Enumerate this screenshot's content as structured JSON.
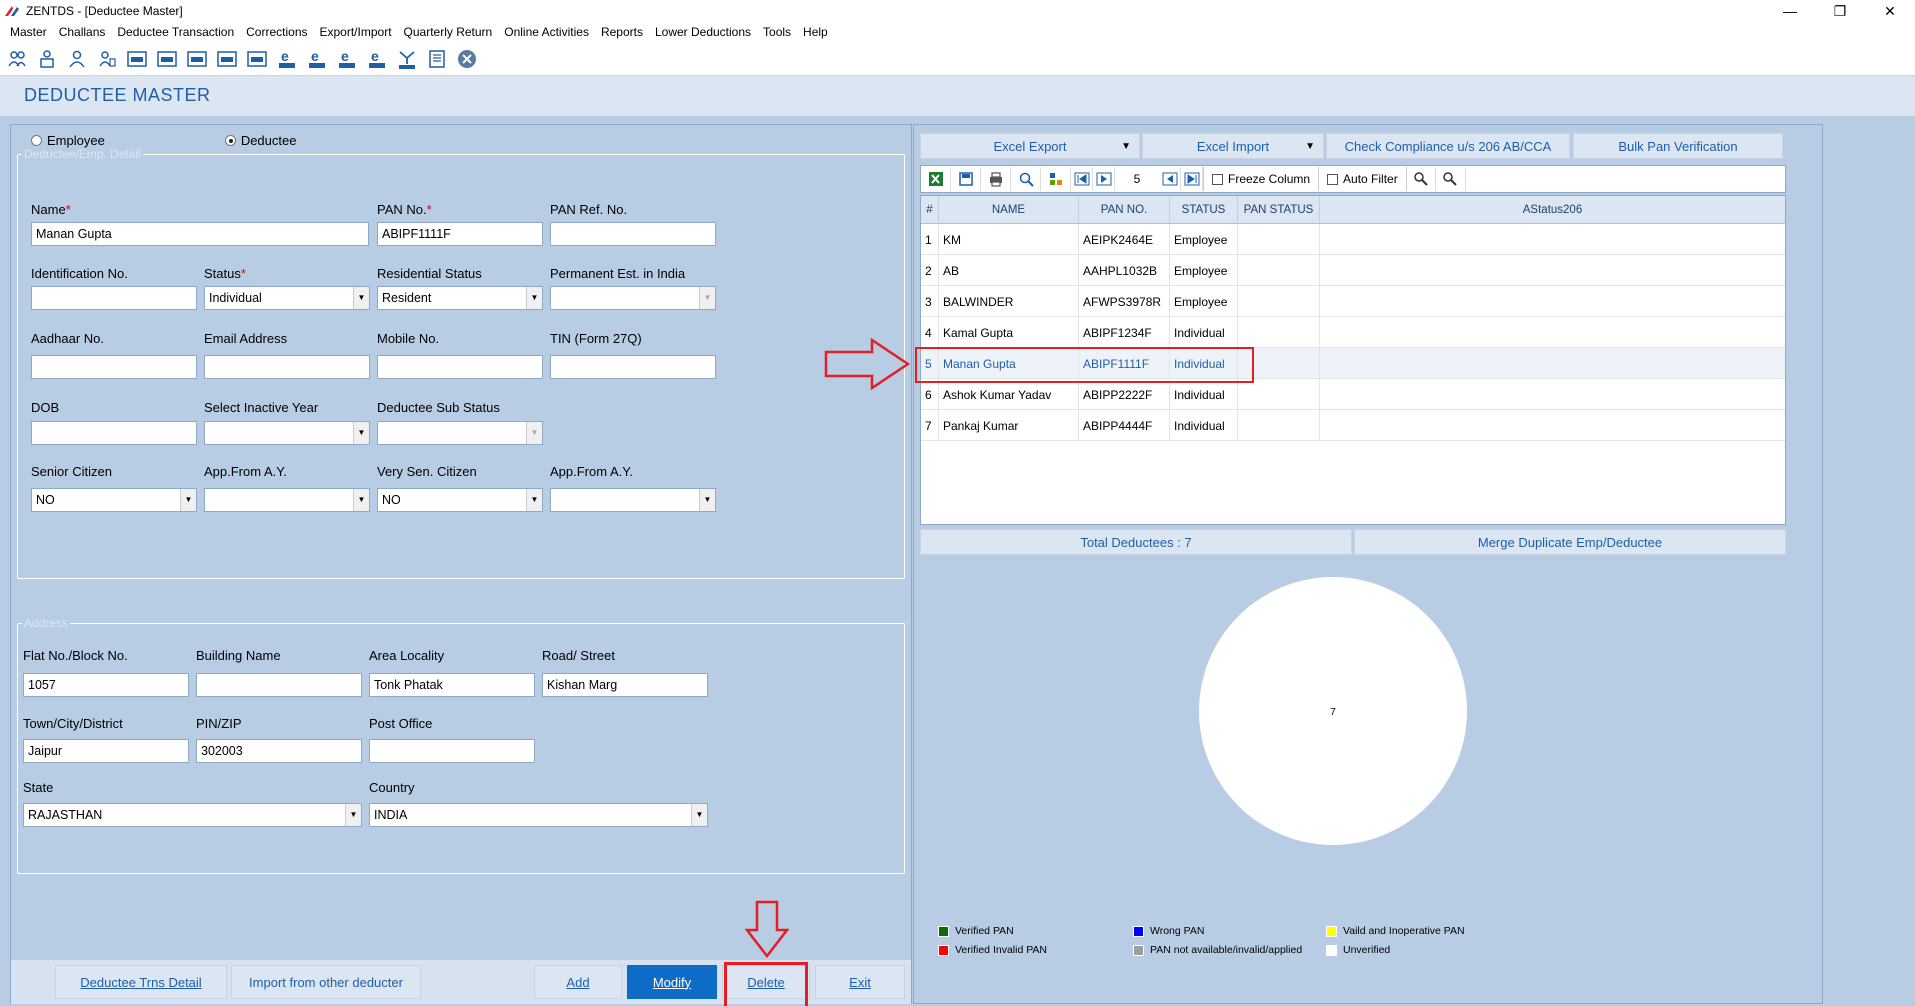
{
  "window": {
    "title": "ZENTDS - [Deductee Master]",
    "minimize": "—",
    "maximize": "❐",
    "close": "✕"
  },
  "menu": [
    "Master",
    "Challans",
    "Deductee Transaction",
    "Corrections",
    "Export/Import",
    "Quarterly Return",
    "Online Activities",
    "Reports",
    "Lower Deductions",
    "Tools",
    "Help"
  ],
  "toolbar_icons": [
    "users-icon",
    "group-icon",
    "user-icon",
    "person-icon",
    "form-16-icon",
    "form-24q-icon",
    "form-26q-icon",
    "form-27q-icon",
    "form-27eq-icon",
    "form-24g-icon",
    "form-26q-e-icon",
    "form-27q-e-icon",
    "form-27eq-e-icon",
    "tds-icon",
    "notes-icon",
    "close-circle-icon"
  ],
  "page_title": "DEDUCTEE MASTER",
  "type_selector": {
    "employee_label": "Employee",
    "deductee_label": "Deductee",
    "selected": "Deductee"
  },
  "detail": {
    "legend": "Deductee/Emp. Detail",
    "name": {
      "label": "Name",
      "value": "Manan Gupta"
    },
    "pan": {
      "label": "PAN No.",
      "value": "ABIPF1111F"
    },
    "pan_ref": {
      "label": "PAN Ref. No.",
      "value": ""
    },
    "identification": {
      "label": "Identification No.",
      "value": ""
    },
    "status": {
      "label": "Status",
      "value": "Individual"
    },
    "residential_status": {
      "label": "Residential Status",
      "value": "Resident"
    },
    "permanent_est": {
      "label": "Permanent Est. in India",
      "value": ""
    },
    "aadhaar": {
      "label": "Aadhaar No.",
      "value": ""
    },
    "email": {
      "label": "Email Address",
      "value": ""
    },
    "mobile": {
      "label": "Mobile No.",
      "value": ""
    },
    "tin": {
      "label": "TIN (Form 27Q)",
      "value": ""
    },
    "dob": {
      "label": "DOB",
      "value": ""
    },
    "inactive_year": {
      "label": "Select Inactive Year",
      "value": ""
    },
    "sub_status": {
      "label": "Deductee Sub Status",
      "value": ""
    },
    "senior_citizen": {
      "label": "Senior Citizen",
      "value": "NO"
    },
    "app_from_ay_1": {
      "label": "App.From A.Y.",
      "value": ""
    },
    "very_senior": {
      "label": "Very Sen. Citizen",
      "value": "NO"
    },
    "app_from_ay_2": {
      "label": "App.From A.Y.",
      "value": ""
    },
    "required_mark": "*"
  },
  "address": {
    "legend": "Address",
    "flat": {
      "label": "Flat No./Block No.",
      "value": "1057"
    },
    "building": {
      "label": "Building Name",
      "value": ""
    },
    "area": {
      "label": "Area Locality",
      "value": "Tonk Phatak"
    },
    "road": {
      "label": "Road/ Street",
      "value": "Kishan Marg"
    },
    "town": {
      "label": "Town/City/District",
      "value": "Jaipur"
    },
    "pin": {
      "label": "PIN/ZIP",
      "value": "302003"
    },
    "post_office": {
      "label": "Post Office",
      "value": ""
    },
    "state": {
      "label": "State",
      "value": "RAJASTHAN"
    },
    "country": {
      "label": "Country",
      "value": "INDIA"
    }
  },
  "actions": {
    "trns_detail": "Deductee Trns Detail",
    "import_other": "Import from other deducter",
    "add": "Add",
    "modify": "Modify",
    "delete": "Delete",
    "exit": "Exit"
  },
  "right_actions": {
    "excel_export": "Excel Export",
    "excel_import": "Excel Import",
    "check_compliance": "Check Compliance u/s 206 AB/CCA",
    "bulk_pan": "Bulk Pan Verification",
    "dropdown_glyph": "▼"
  },
  "grid_toolbar": {
    "page": "5",
    "freeze_column": "Freeze Column",
    "auto_filter": "Auto Filter"
  },
  "grid": {
    "columns": [
      "#",
      "NAME",
      "PAN NO.",
      "STATUS",
      "PAN STATUS",
      "AStatus206"
    ],
    "rows": [
      [
        "1",
        "KM",
        "AEIPK2464E",
        "Employee",
        "",
        ""
      ],
      [
        "2",
        "AB",
        "AAHPL1032B",
        "Employee",
        "",
        ""
      ],
      [
        "3",
        "BALWINDER",
        "AFWPS3978R",
        "Employee",
        "",
        ""
      ],
      [
        "4",
        "Kamal Gupta",
        "ABIPF1234F",
        "Individual",
        "",
        ""
      ],
      [
        "5",
        "Manan Gupta",
        "ABIPF1111F",
        "Individual",
        "",
        ""
      ],
      [
        "6",
        "Ashok Kumar Yadav",
        "ABIPP2222F",
        "Individual",
        "",
        ""
      ],
      [
        "7",
        "Pankaj Kumar",
        "ABIPP4444F",
        "Individual",
        "",
        ""
      ]
    ],
    "selected_row": 4
  },
  "summary": {
    "total": "Total Deductees : 7",
    "merge": "Merge Duplicate Emp/Deductee"
  },
  "chart_data": {
    "type": "pie",
    "categories": [
      "Unverified"
    ],
    "values": [
      7
    ],
    "data_label": "7",
    "colors": [
      "#ffffff"
    ]
  },
  "legend": [
    {
      "label": "Verified PAN",
      "color": "#0a6b0a"
    },
    {
      "label": "Wrong PAN",
      "color": "#0000ff"
    },
    {
      "label": "Vaild and Inoperative PAN",
      "color": "#ffff00"
    },
    {
      "label": "Verified Invalid PAN",
      "color": "#ff0000"
    },
    {
      "label": "PAN not available/invalid/applied",
      "color": "#9e9e9e"
    },
    {
      "label": "Unverified",
      "color": "#ffffff"
    }
  ],
  "colors": {
    "accent": "#1f5fa8",
    "primary_button": "#0f6cc6",
    "annotation": "#e31e24",
    "panel": "#b8cce4"
  }
}
